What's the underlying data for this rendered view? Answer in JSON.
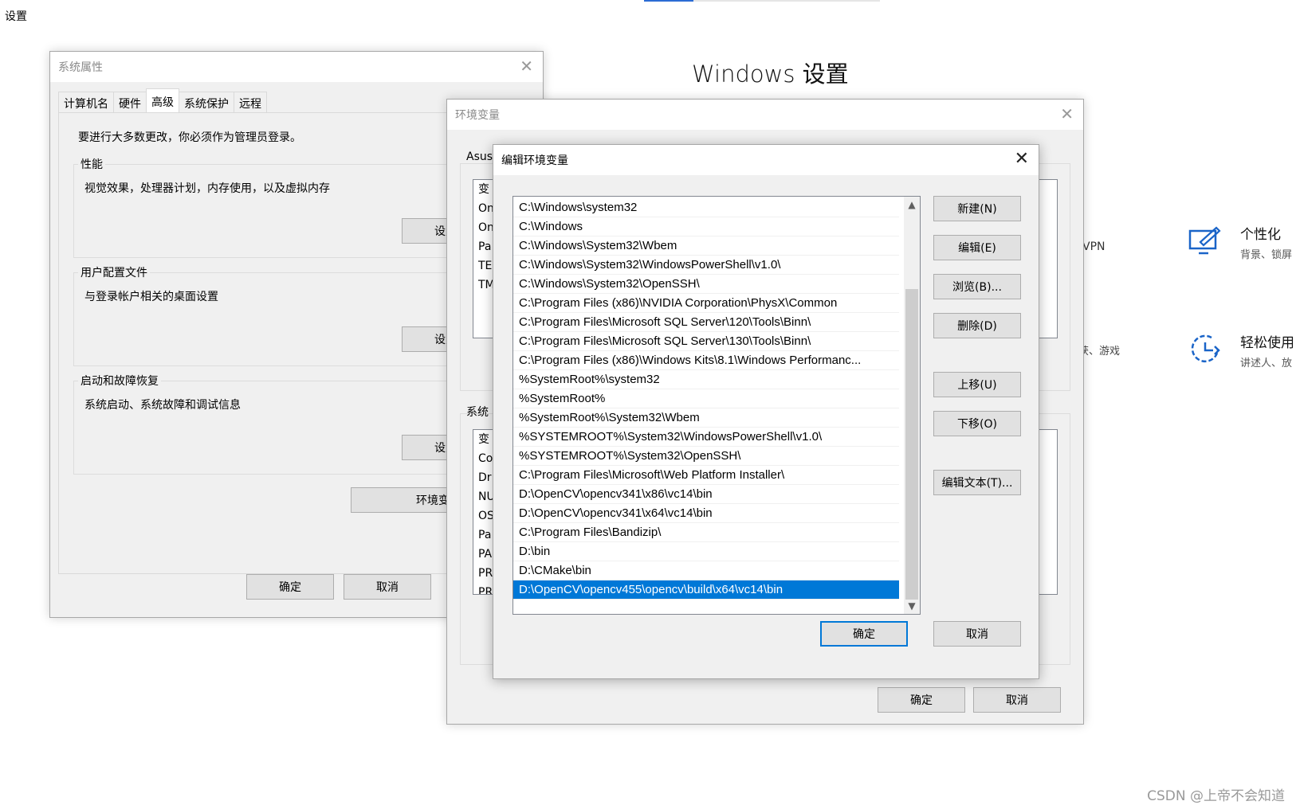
{
  "app": {
    "title": "设置",
    "heading": "Windows 设置",
    "vpn_fragment": "VPN",
    "game_fragment": "捕获、游戏",
    "categories": [
      {
        "title": "个性化",
        "subtitle": "背景、锁屏",
        "icon": "personalization-icon"
      },
      {
        "title": "轻松使用",
        "subtitle": "讲述人、放",
        "icon": "ease-of-access-icon"
      }
    ],
    "watermark": "CSDN @上帝不会知道"
  },
  "system_properties": {
    "title": "系统属性",
    "tabs": [
      "计算机名",
      "硬件",
      "高级",
      "系统保护",
      "远程"
    ],
    "admin_note": "要进行大多数更改，你必须作为管理员登录。",
    "groups": [
      {
        "label": "性能",
        "desc": "视觉效果，处理器计划，内存使用，以及虚拟内存",
        "button": "设置"
      },
      {
        "label": "用户配置文件",
        "desc": "与登录帐户相关的桌面设置",
        "button": "设置"
      },
      {
        "label": "启动和故障恢复",
        "desc": "系统启动、系统故障和调试信息",
        "button": "设置"
      }
    ],
    "env_button": "环境变量",
    "ok": "确定",
    "cancel": "取消"
  },
  "env_vars": {
    "title": "环境变量",
    "user_group_prefix": "Asus",
    "user_rows": [
      "变",
      "On",
      "On",
      "Pa",
      "TE",
      "TM"
    ],
    "sys_group_prefix": "系统",
    "sys_rows": [
      "变",
      "Co",
      "Dr",
      "NU",
      "OS",
      "Pa",
      "PA",
      "PR",
      "PR"
    ],
    "ok": "确定",
    "cancel": "取消"
  },
  "edit_env": {
    "title": "编辑环境变量",
    "paths": [
      "C:\\Windows\\system32",
      "C:\\Windows",
      "C:\\Windows\\System32\\Wbem",
      "C:\\Windows\\System32\\WindowsPowerShell\\v1.0\\",
      "C:\\Windows\\System32\\OpenSSH\\",
      "C:\\Program Files (x86)\\NVIDIA Corporation\\PhysX\\Common",
      "C:\\Program Files\\Microsoft SQL Server\\120\\Tools\\Binn\\",
      "C:\\Program Files\\Microsoft SQL Server\\130\\Tools\\Binn\\",
      "C:\\Program Files (x86)\\Windows Kits\\8.1\\Windows Performanc...",
      "%SystemRoot%\\system32",
      "%SystemRoot%",
      "%SystemRoot%\\System32\\Wbem",
      "%SYSTEMROOT%\\System32\\WindowsPowerShell\\v1.0\\",
      "%SYSTEMROOT%\\System32\\OpenSSH\\",
      "C:\\Program Files\\Microsoft\\Web Platform Installer\\",
      "D:\\OpenCV\\opencv341\\x86\\vc14\\bin",
      "D:\\OpenCV\\opencv341\\x64\\vc14\\bin",
      "C:\\Program Files\\Bandizip\\",
      "D:\\bin",
      "D:\\CMake\\bin",
      "D:\\OpenCV\\opencv455\\opencv\\build\\x64\\vc14\\bin"
    ],
    "selected_index": 20,
    "buttons": {
      "new": "新建(N)",
      "edit": "编辑(E)",
      "browse": "浏览(B)...",
      "delete": "删除(D)",
      "up": "上移(U)",
      "down": "下移(O)",
      "edit_text": "编辑文本(T)..."
    },
    "ok": "确定",
    "cancel": "取消"
  }
}
